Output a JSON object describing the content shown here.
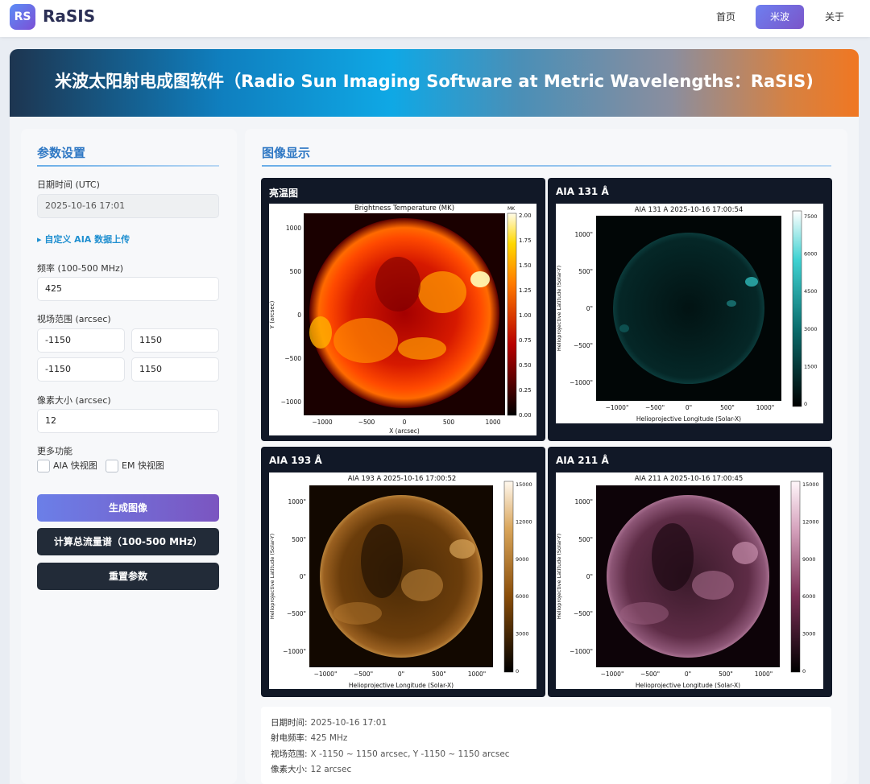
{
  "nav": {
    "logo": "RS",
    "brand": "RaSIS",
    "items": [
      "首页",
      "米波",
      "关于"
    ]
  },
  "banner": {
    "title": "米波太阳射电成图软件（Radio Sun Imaging Software at Metric Wavelengths：RaSIS)"
  },
  "params": {
    "section_title": "参数设置",
    "datetime_label": "日期时间 (UTC)",
    "datetime_value": "2025-10-16 17:01",
    "aia_upload": "▸ 自定义 AIA 数据上传",
    "freq_label": "频率 (100-500 MHz)",
    "freq_value": "425",
    "fov_label": "视场范围 (arcsec)",
    "fov_x_min": "-1150",
    "fov_x_max": "1150",
    "fov_y_min": "-1150",
    "fov_y_max": "1150",
    "pixel_label": "像素大小 (arcsec)",
    "pixel_value": "12",
    "more_label": "更多功能",
    "aia_quick": "AIA 快视图",
    "em_quick": "EM 快视图",
    "btn_generate": "生成图像",
    "btn_flux": "计算总流量谱（100-500 MHz）",
    "btn_reset": "重置参数"
  },
  "display": {
    "section_title": "图像显示",
    "panels": [
      {
        "card_title": "亮温图",
        "plot_title": "Brightness Temperature (MK)",
        "xlabel": "X (arcsec)",
        "ylabel": "Y (arcsec)",
        "xticks": [
          "−1000",
          "−500",
          "0",
          "500",
          "1000"
        ],
        "yticks": [
          "1000",
          "500",
          "0",
          "−500",
          "−1000"
        ],
        "cbar_unit": "MK",
        "cbar_ticks": [
          "2.00",
          "1.75",
          "1.50",
          "1.25",
          "1.00",
          "0.75",
          "0.50",
          "0.25",
          "0.00"
        ]
      },
      {
        "card_title": "AIA 131 Å",
        "plot_title": "AIA 131 A 2025-10-16 17:00:54",
        "xlabel": "Helioprojective Longitude (Solar-X)",
        "ylabel": "Helioprojective Latitude (Solar-Y)",
        "xticks": [
          "−1000\"",
          "−500\"",
          "0\"",
          "500\"",
          "1000\""
        ],
        "yticks": [
          "1000\"",
          "500\"",
          "0\"",
          "−500\"",
          "−1000\""
        ],
        "cbar_ticks": [
          "7500",
          "6000",
          "4500",
          "3000",
          "1500",
          "0"
        ]
      },
      {
        "card_title": "AIA 193 Å",
        "plot_title": "AIA 193 A 2025-10-16 17:00:52",
        "xlabel": "Helioprojective Longitude (Solar-X)",
        "ylabel": "Helioprojective Latitude (Solar-Y)",
        "xticks": [
          "−1000\"",
          "−500\"",
          "0\"",
          "500\"",
          "1000\""
        ],
        "yticks": [
          "1000\"",
          "500\"",
          "0\"",
          "−500\"",
          "−1000\""
        ],
        "cbar_ticks": [
          "15000",
          "12000",
          "9000",
          "6000",
          "3000",
          "0"
        ]
      },
      {
        "card_title": "AIA 211 Å",
        "plot_title": "AIA 211 A 2025-10-16 17:00:45",
        "xlabel": "Helioprojective Longitude (Solar-X)",
        "ylabel": "Helioprojective Latitude (Solar-Y)",
        "xticks": [
          "−1000\"",
          "−500\"",
          "0\"",
          "500\"",
          "1000\""
        ],
        "yticks": [
          "1000\"",
          "500\"",
          "0\"",
          "−500\"",
          "−1000\""
        ],
        "cbar_ticks": [
          "15000",
          "12000",
          "9000",
          "6000",
          "3000",
          "0"
        ]
      }
    ]
  },
  "info": {
    "date_key": "日期时间:",
    "date_val": "2025-10-16 17:01",
    "freq_key": "射电频率:",
    "freq_val": "425 MHz",
    "fov_key": "视场范围:",
    "fov_val": "X -1150 ~ 1150 arcsec, Y -1150 ~ 1150 arcsec",
    "pix_key": "像素大小:",
    "pix_val": "12 arcsec"
  },
  "colors": {
    "accent": "#6d7ff0",
    "dark_button": "#222b38",
    "card_bg": "#111827",
    "section_title": "#2f78c4"
  }
}
